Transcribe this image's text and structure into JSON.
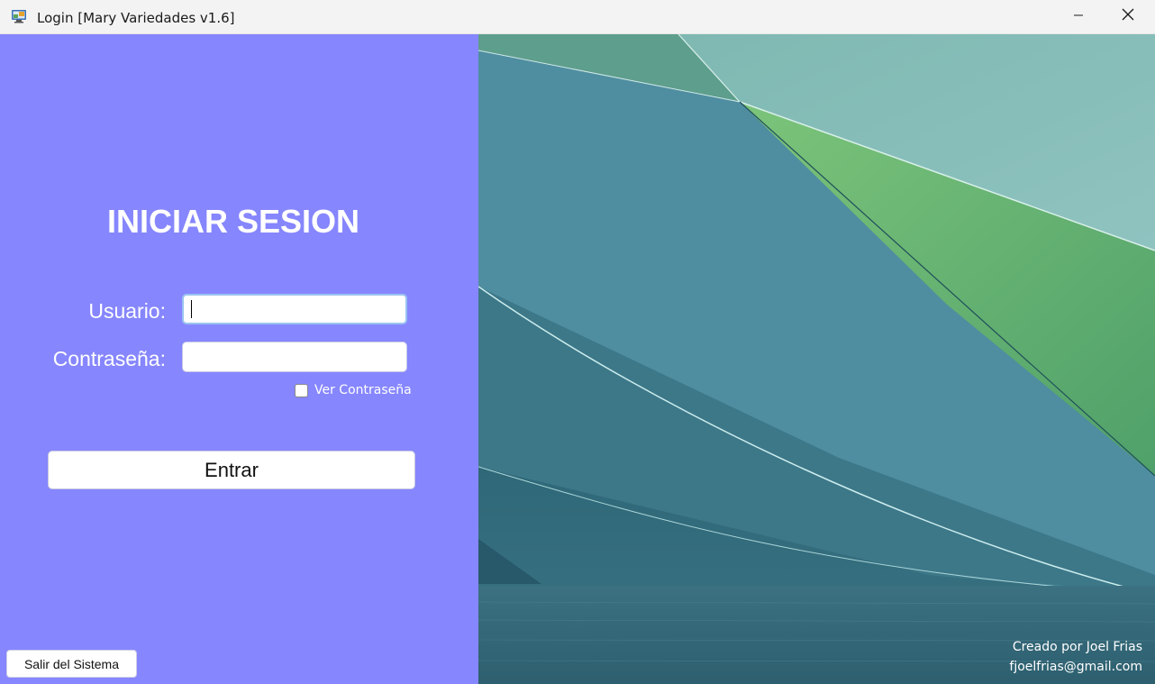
{
  "window": {
    "title": "Login [Mary Variedades v1.6]",
    "icon": "computer-icon",
    "minimize_icon": "minimize-icon",
    "close_icon": "close-icon"
  },
  "login": {
    "heading": "INICIAR SESION",
    "user_label": "Usuario:",
    "user_value": "",
    "password_label": "Contraseña:",
    "password_value": "",
    "show_password_label": "Ver Contraseña",
    "show_password_checked": false,
    "submit_label": "Entrar",
    "exit_label": "Salir del Sistema"
  },
  "footer": {
    "created_by": "Creado por Joel Frias",
    "email": "fjoelfrias@gmail.com"
  },
  "colors": {
    "left_panel_bg": "#8686fe",
    "button_bg": "#ffffff",
    "text_light": "#ffffff"
  }
}
